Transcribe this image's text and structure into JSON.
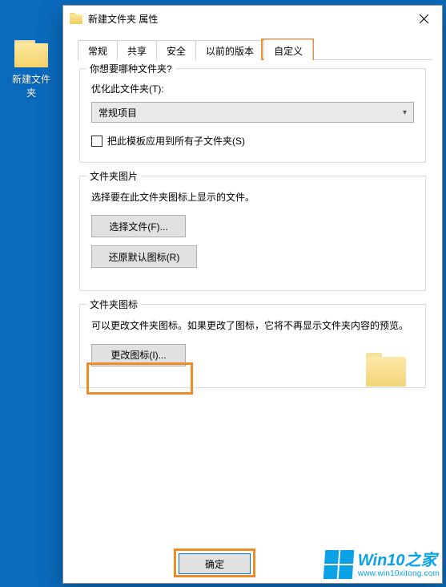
{
  "desktop": {
    "folder_label": "新建文件夹"
  },
  "dialog": {
    "title": "新建文件夹 属性",
    "tabs": {
      "general": "常规",
      "sharing": "共享",
      "security": "安全",
      "previous": "以前的版本",
      "customize": "自定义"
    },
    "group1": {
      "title": "你想要哪种文件夹?",
      "optimize_label": "优化此文件夹(T):",
      "combo_value": "常规项目",
      "apply_checkbox": "把此模板应用到所有子文件夹(S)"
    },
    "group2": {
      "title": "文件夹图片",
      "desc": "选择要在此文件夹图标上显示的文件。",
      "choose_btn": "选择文件(F)...",
      "restore_btn": "还原默认图标(R)"
    },
    "group3": {
      "title": "文件夹图标",
      "desc": "可以更改文件夹图标。如果更改了图标，它将不再显示文件夹内容的预览。",
      "change_btn": "更改图标(I)..."
    },
    "buttons": {
      "ok": "确定"
    }
  },
  "watermark": {
    "brand": "Win10之家",
    "url": "www.win10xitong.com"
  }
}
